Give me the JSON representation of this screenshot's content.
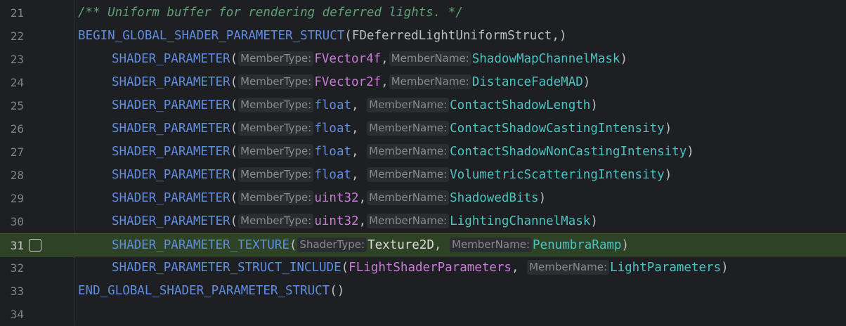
{
  "editor": {
    "lines": [
      {
        "n": "21",
        "indent": 0,
        "kind": "comment",
        "text": "/** Uniform buffer for rendering deferred lights. */"
      },
      {
        "n": "22",
        "indent": 0,
        "kind": "begin",
        "macro": "BEGIN_GLOBAL_SHADER_PARAMETER_STRUCT",
        "arg": "FDeferredLightUniformStruct,"
      },
      {
        "n": "23",
        "indent": 1,
        "kind": "param",
        "macro": "SHADER_PARAMETER",
        "h1": "MemberType:",
        "t": "FVector4f",
        "h2": "MemberName:",
        "v": "ShadowMapChannelMask",
        "tclass": "type"
      },
      {
        "n": "24",
        "indent": 1,
        "kind": "param",
        "macro": "SHADER_PARAMETER",
        "h1": "MemberType:",
        "t": "FVector2f",
        "h2": "MemberName:",
        "v": "DistanceFadeMAD",
        "tclass": "type"
      },
      {
        "n": "25",
        "indent": 1,
        "kind": "param",
        "macro": "SHADER_PARAMETER",
        "h1": "MemberType:",
        "t": "float",
        "h2": "MemberName:",
        "v": "ContactShadowLength",
        "tclass": "macro",
        "pad": " "
      },
      {
        "n": "26",
        "indent": 1,
        "kind": "param",
        "macro": "SHADER_PARAMETER",
        "h1": "MemberType:",
        "t": "float",
        "h2": "MemberName:",
        "v": "ContactShadowCastingIntensity",
        "tclass": "macro",
        "pad": " "
      },
      {
        "n": "27",
        "indent": 1,
        "kind": "param",
        "macro": "SHADER_PARAMETER",
        "h1": "MemberType:",
        "t": "float",
        "h2": "MemberName:",
        "v": "ContactShadowNonCastingIntensity",
        "tclass": "macro",
        "pad": " "
      },
      {
        "n": "28",
        "indent": 1,
        "kind": "param",
        "macro": "SHADER_PARAMETER",
        "h1": "MemberType:",
        "t": "float",
        "h2": "MemberName:",
        "v": "VolumetricScatteringIntensity",
        "tclass": "macro",
        "pad": " "
      },
      {
        "n": "29",
        "indent": 1,
        "kind": "param",
        "macro": "SHADER_PARAMETER",
        "h1": "MemberType:",
        "t": "uint32",
        "h2": "MemberName:",
        "v": "ShadowedBits",
        "tclass": "type"
      },
      {
        "n": "30",
        "indent": 1,
        "kind": "param",
        "macro": "SHADER_PARAMETER",
        "h1": "MemberType:",
        "t": "uint32",
        "h2": "MemberName:",
        "v": "LightingChannelMask",
        "tclass": "type"
      },
      {
        "n": "31",
        "indent": 1,
        "kind": "param",
        "current": true,
        "macro": "SHADER_PARAMETER_TEXTURE",
        "h1": "ShaderType:",
        "t": "Texture2D",
        "h2": "MemberName:",
        "v": "PenumbraRamp",
        "tclass": "typeplain",
        "pad": " "
      },
      {
        "n": "32",
        "indent": 1,
        "kind": "param",
        "macro": "SHADER_PARAMETER_STRUCT_INCLUDE",
        "h1": "",
        "t": "FLightShaderParameters",
        "h2": "MemberName:",
        "v": "LightParameters",
        "tclass": "type",
        "pad": " "
      },
      {
        "n": "33",
        "indent": 0,
        "kind": "end",
        "macro": "END_GLOBAL_SHADER_PARAMETER_STRUCT",
        "arg": "()"
      },
      {
        "n": "34",
        "indent": 0,
        "kind": "empty"
      }
    ]
  }
}
